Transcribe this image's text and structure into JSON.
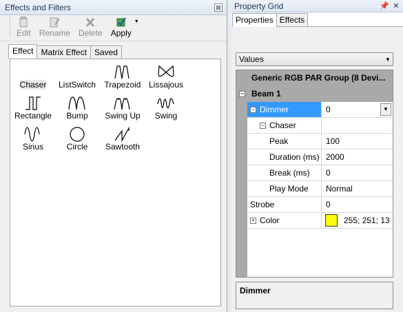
{
  "left_panel": {
    "title": "Effects and Filters",
    "close_glyph": "⊠",
    "toolbar": {
      "edit_label": "Edit",
      "rename_label": "Rename",
      "delete_label": "Delete",
      "apply_label": "Apply"
    },
    "tabs": [
      "Effect",
      "Matrix Effect",
      "Saved"
    ],
    "active_tab": "Effect",
    "effects": [
      {
        "label": "Chaser",
        "icon": "chaser-icon"
      },
      {
        "label": "ListSwitch",
        "icon": "listswitch-icon"
      },
      {
        "label": "Trapezoid",
        "icon": "trapezoid-icon"
      },
      {
        "label": "Lissajous",
        "icon": "lissajous-icon"
      },
      {
        "label": "Rectangle",
        "icon": "rectangle-wave-icon"
      },
      {
        "label": "Bump",
        "icon": "bump-icon"
      },
      {
        "label": "Swing Up",
        "icon": "swing-up-icon"
      },
      {
        "label": "Swing",
        "icon": "swing-icon"
      },
      {
        "label": "Sinus",
        "icon": "sinus-icon"
      },
      {
        "label": "Circle",
        "icon": "circle-icon"
      },
      {
        "label": "Sawtooth",
        "icon": "sawtooth-icon"
      }
    ],
    "selected_effect": "Chaser"
  },
  "right_panel": {
    "title": "Property Grid",
    "tabs": [
      "Properties",
      "Effects"
    ],
    "active_tab": "Properties",
    "view_select": "Values",
    "group_header": "Generic RGB PAR Group (8 Devi...",
    "beam_label": "Beam 1",
    "rows": {
      "dimmer": {
        "name": "Dimmer",
        "value": "0"
      },
      "chaser": {
        "name": "Chaser"
      },
      "peak": {
        "name": "Peak",
        "value": "100"
      },
      "duration": {
        "name": "Duration (ms)",
        "value": "2000"
      },
      "break": {
        "name": "Break (ms)",
        "value": "0"
      },
      "play_mode": {
        "name": "Play Mode",
        "value": "Normal"
      },
      "strobe": {
        "name": "Strobe",
        "value": "0"
      },
      "color": {
        "name": "Color",
        "value": "255; 251; 13",
        "swatch": "#fffb0d"
      }
    },
    "description_title": "Dimmer"
  },
  "colors": {
    "selection": "#3399ff",
    "grid_gutter": "#a9a9a9"
  }
}
